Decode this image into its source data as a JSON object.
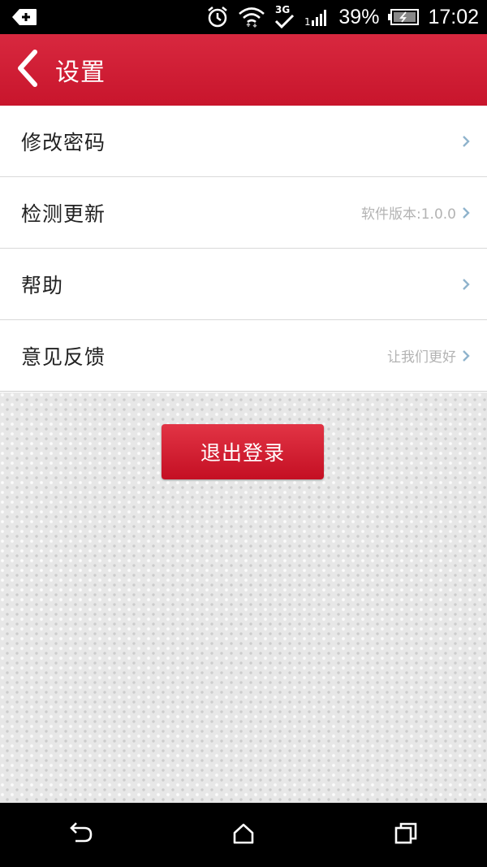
{
  "status_bar": {
    "battery": "39%",
    "time": "17:02",
    "icons": [
      "back-plus-icon",
      "alarm-icon",
      "wifi-icon",
      "3g-icon",
      "signal-icon",
      "battery-icon"
    ]
  },
  "header": {
    "title": "设置",
    "back_icon": "chevron-left-icon"
  },
  "menu": {
    "items": [
      {
        "label": "修改密码",
        "hint": ""
      },
      {
        "label": "检测更新",
        "hint": "软件版本:1.0.0"
      },
      {
        "label": "帮助",
        "hint": ""
      },
      {
        "label": "意见反馈",
        "hint": "让我们更好"
      }
    ]
  },
  "logout": {
    "label": "退出登录"
  },
  "navbar": {
    "icons": [
      "back-icon",
      "home-icon",
      "recent-apps-icon"
    ]
  },
  "colors": {
    "header_red": "#d01c33",
    "button_red": "#c40f23",
    "hint_gray": "#b3b3b3",
    "chevron_blue": "#8fb3cc"
  }
}
